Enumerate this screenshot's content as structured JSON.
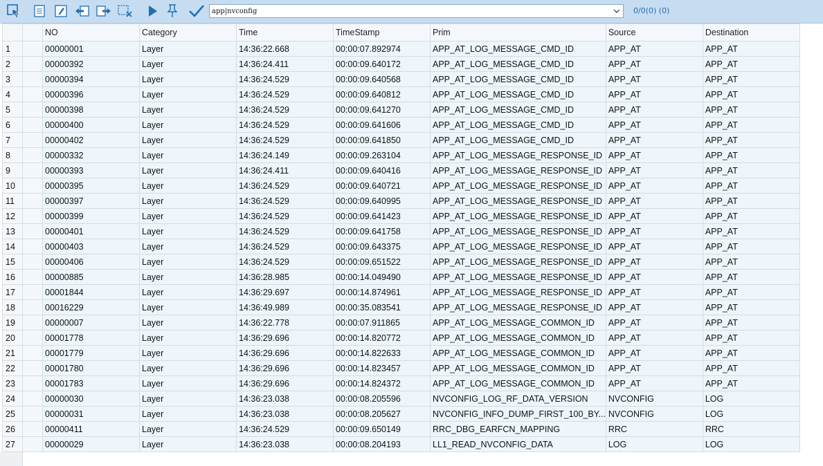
{
  "toolbar": {
    "buttons": [
      {
        "name": "select-arrow-icon"
      },
      {
        "name": "document-icon"
      },
      {
        "name": "edit-icon"
      },
      {
        "name": "import-icon"
      },
      {
        "name": "export-icon"
      },
      {
        "name": "clear-selection-icon"
      },
      {
        "name": "play-icon"
      },
      {
        "name": "pin-icon"
      },
      {
        "name": "checkmark-icon"
      }
    ],
    "filter_value": "app|nvconfig",
    "counts": "0/0(0) (0)",
    "accent": "#1f6fb3"
  },
  "table": {
    "columns": [
      "NO",
      "Category",
      "Time",
      "TimeStamp",
      "Prim",
      "Source",
      "Destination"
    ],
    "rows": [
      [
        "1",
        "00000001",
        "Layer",
        "14:36:22.668",
        "00:00:07.892974",
        "APP_AT_LOG_MESSAGE_CMD_ID",
        "APP_AT",
        "APP_AT"
      ],
      [
        "2",
        "00000392",
        "Layer",
        "14:36:24.411",
        "00:00:09.640172",
        "APP_AT_LOG_MESSAGE_CMD_ID",
        "APP_AT",
        "APP_AT"
      ],
      [
        "3",
        "00000394",
        "Layer",
        "14:36:24.529",
        "00:00:09.640568",
        "APP_AT_LOG_MESSAGE_CMD_ID",
        "APP_AT",
        "APP_AT"
      ],
      [
        "4",
        "00000396",
        "Layer",
        "14:36:24.529",
        "00:00:09.640812",
        "APP_AT_LOG_MESSAGE_CMD_ID",
        "APP_AT",
        "APP_AT"
      ],
      [
        "5",
        "00000398",
        "Layer",
        "14:36:24.529",
        "00:00:09.641270",
        "APP_AT_LOG_MESSAGE_CMD_ID",
        "APP_AT",
        "APP_AT"
      ],
      [
        "6",
        "00000400",
        "Layer",
        "14:36:24.529",
        "00:00:09.641606",
        "APP_AT_LOG_MESSAGE_CMD_ID",
        "APP_AT",
        "APP_AT"
      ],
      [
        "7",
        "00000402",
        "Layer",
        "14:36:24.529",
        "00:00:09.641850",
        "APP_AT_LOG_MESSAGE_CMD_ID",
        "APP_AT",
        "APP_AT"
      ],
      [
        "8",
        "00000332",
        "Layer",
        "14:36:24.149",
        "00:00:09.263104",
        "APP_AT_LOG_MESSAGE_RESPONSE_ID",
        "APP_AT",
        "APP_AT"
      ],
      [
        "9",
        "00000393",
        "Layer",
        "14:36:24.411",
        "00:00:09.640416",
        "APP_AT_LOG_MESSAGE_RESPONSE_ID",
        "APP_AT",
        "APP_AT"
      ],
      [
        "10",
        "00000395",
        "Layer",
        "14:36:24.529",
        "00:00:09.640721",
        "APP_AT_LOG_MESSAGE_RESPONSE_ID",
        "APP_AT",
        "APP_AT"
      ],
      [
        "11",
        "00000397",
        "Layer",
        "14:36:24.529",
        "00:00:09.640995",
        "APP_AT_LOG_MESSAGE_RESPONSE_ID",
        "APP_AT",
        "APP_AT"
      ],
      [
        "12",
        "00000399",
        "Layer",
        "14:36:24.529",
        "00:00:09.641423",
        "APP_AT_LOG_MESSAGE_RESPONSE_ID",
        "APP_AT",
        "APP_AT"
      ],
      [
        "13",
        "00000401",
        "Layer",
        "14:36:24.529",
        "00:00:09.641758",
        "APP_AT_LOG_MESSAGE_RESPONSE_ID",
        "APP_AT",
        "APP_AT"
      ],
      [
        "14",
        "00000403",
        "Layer",
        "14:36:24.529",
        "00:00:09.643375",
        "APP_AT_LOG_MESSAGE_RESPONSE_ID",
        "APP_AT",
        "APP_AT"
      ],
      [
        "15",
        "00000406",
        "Layer",
        "14:36:24.529",
        "00:00:09.651522",
        "APP_AT_LOG_MESSAGE_RESPONSE_ID",
        "APP_AT",
        "APP_AT"
      ],
      [
        "16",
        "00000885",
        "Layer",
        "14:36:28.985",
        "00:00:14.049490",
        "APP_AT_LOG_MESSAGE_RESPONSE_ID",
        "APP_AT",
        "APP_AT"
      ],
      [
        "17",
        "00001844",
        "Layer",
        "14:36:29.697",
        "00:00:14.874961",
        "APP_AT_LOG_MESSAGE_RESPONSE_ID",
        "APP_AT",
        "APP_AT"
      ],
      [
        "18",
        "00016229",
        "Layer",
        "14:36:49.989",
        "00:00:35.083541",
        "APP_AT_LOG_MESSAGE_RESPONSE_ID",
        "APP_AT",
        "APP_AT"
      ],
      [
        "19",
        "00000007",
        "Layer",
        "14:36:22.778",
        "00:00:07.911865",
        "APP_AT_LOG_MESSAGE_COMMON_ID",
        "APP_AT",
        "APP_AT"
      ],
      [
        "20",
        "00001778",
        "Layer",
        "14:36:29.696",
        "00:00:14.820772",
        "APP_AT_LOG_MESSAGE_COMMON_ID",
        "APP_AT",
        "APP_AT"
      ],
      [
        "21",
        "00001779",
        "Layer",
        "14:36:29.696",
        "00:00:14.822633",
        "APP_AT_LOG_MESSAGE_COMMON_ID",
        "APP_AT",
        "APP_AT"
      ],
      [
        "22",
        "00001780",
        "Layer",
        "14:36:29.696",
        "00:00:14.823457",
        "APP_AT_LOG_MESSAGE_COMMON_ID",
        "APP_AT",
        "APP_AT"
      ],
      [
        "23",
        "00001783",
        "Layer",
        "14:36:29.696",
        "00:00:14.824372",
        "APP_AT_LOG_MESSAGE_COMMON_ID",
        "APP_AT",
        "APP_AT"
      ],
      [
        "24",
        "00000030",
        "Layer",
        "14:36:23.038",
        "00:00:08.205596",
        "NVCONFIG_LOG_RF_DATA_VERSION",
        "NVCONFIG",
        "LOG"
      ],
      [
        "25",
        "00000031",
        "Layer",
        "14:36:23.038",
        "00:00:08.205627",
        "NVCONFIG_INFO_DUMP_FIRST_100_BY...",
        "NVCONFIG",
        "LOG"
      ],
      [
        "26",
        "00000411",
        "Layer",
        "14:36:24.529",
        "00:00:09.650149",
        "RRC_DBG_EARFCN_MAPPING",
        "RRC",
        "RRC"
      ],
      [
        "27",
        "00000029",
        "Layer",
        "14:36:23.038",
        "00:00:08.204193",
        "LL1_READ_NVCONFIG_DATA",
        "LOG",
        "LOG"
      ]
    ]
  }
}
